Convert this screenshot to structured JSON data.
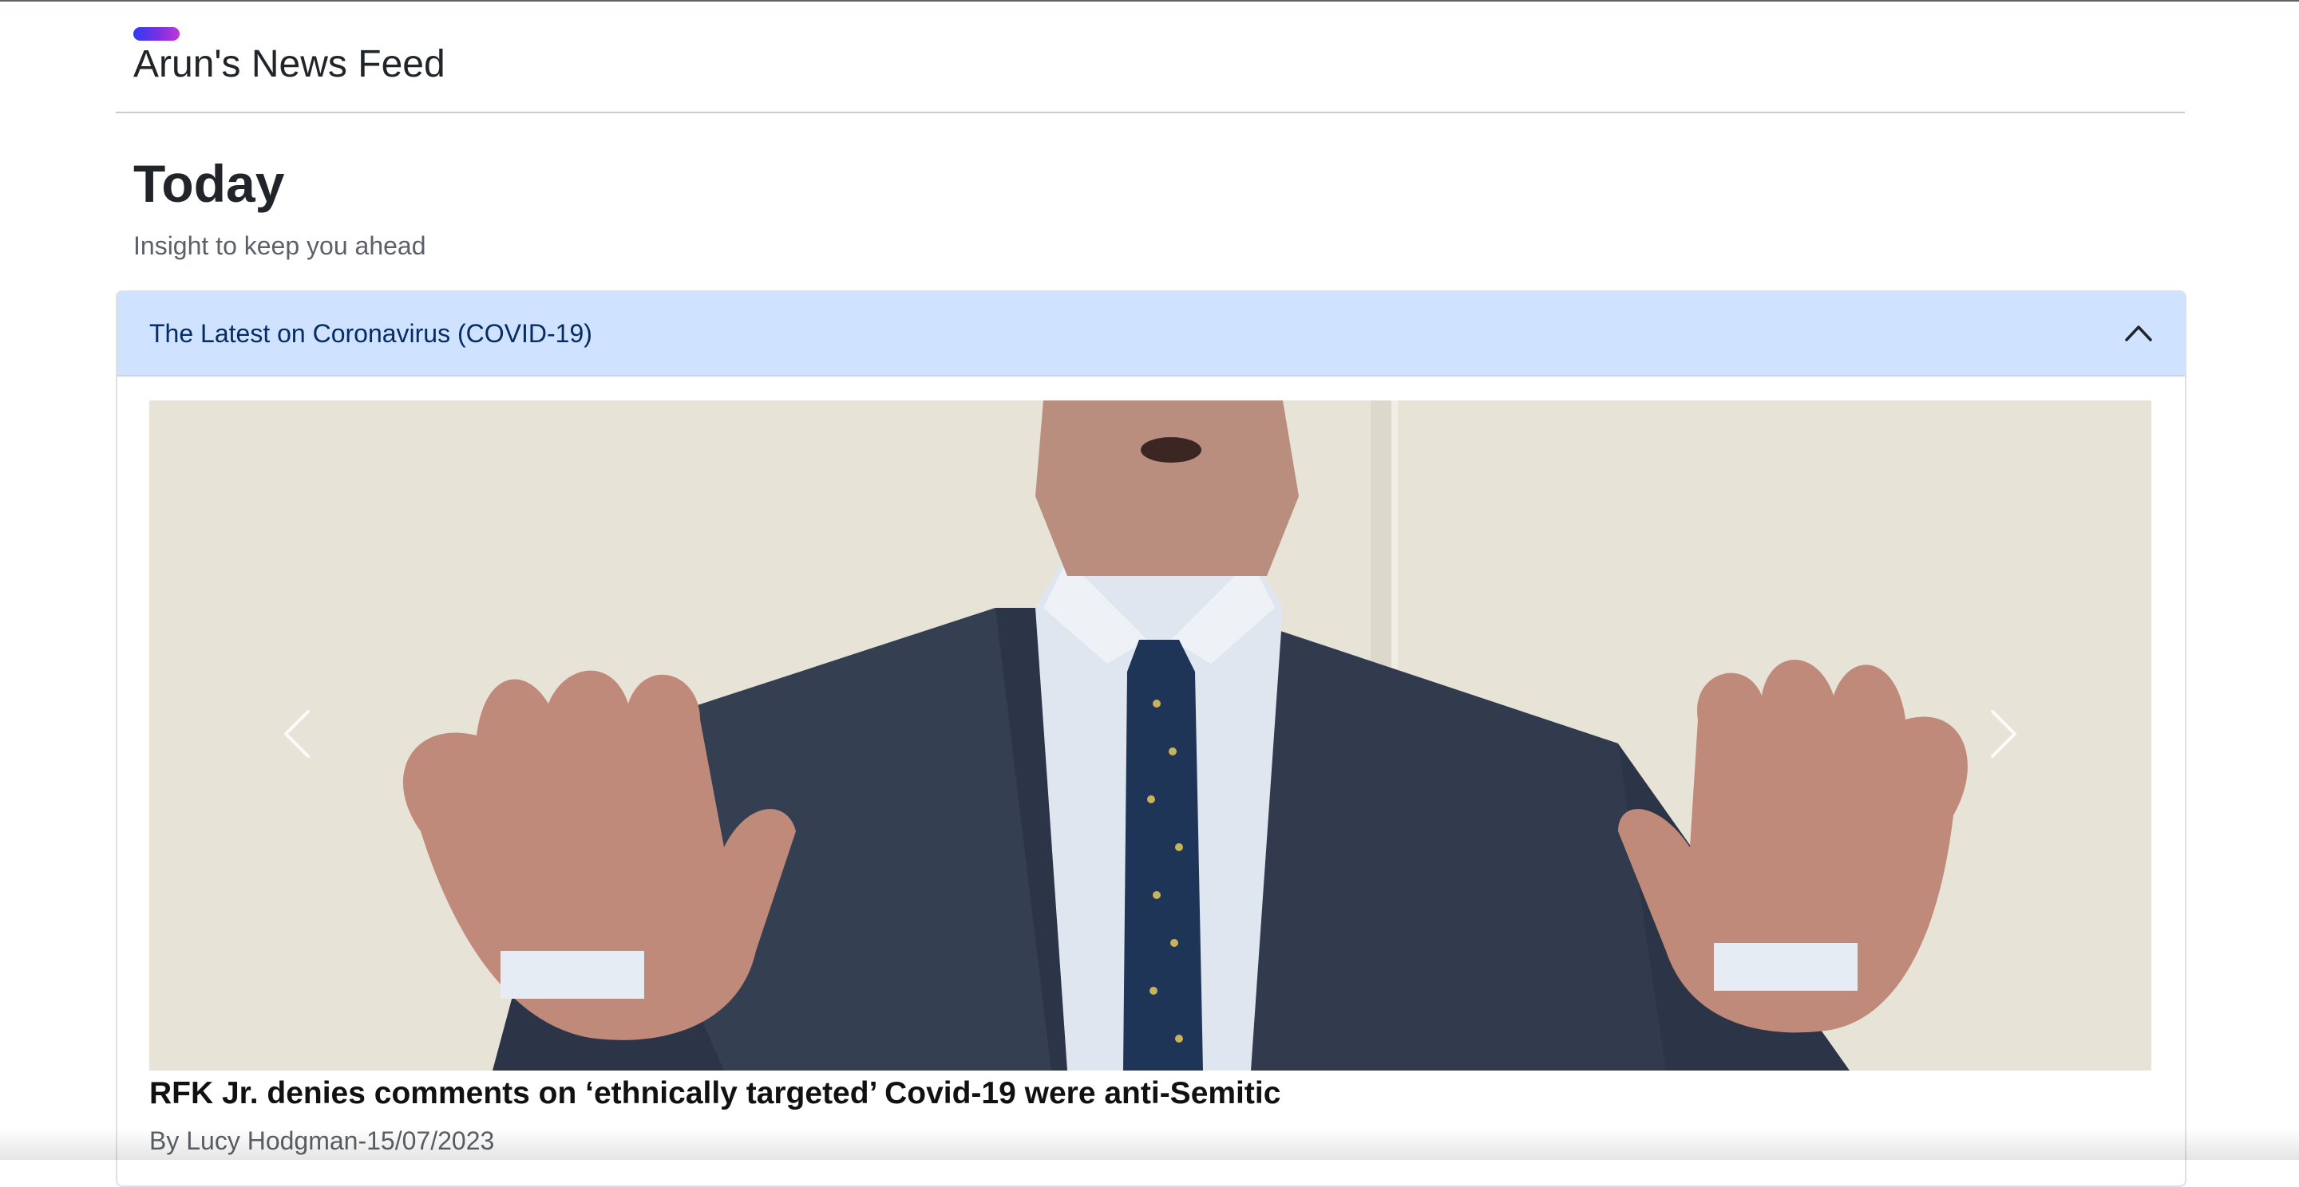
{
  "navbar": {
    "brand": "Arun's News Feed",
    "brand_gradient": [
      "#2f3cf0",
      "#7a2fe3",
      "#c237d6"
    ]
  },
  "page": {
    "title": "Today",
    "subtitle": "Insight to keep you ahead"
  },
  "accordion": {
    "section_title": "The Latest on Coronavirus (COVID-19)",
    "expanded": true,
    "header_bg": "#cfe2ff",
    "toggle_icon": "chevron-up-icon"
  },
  "carousel": {
    "prev_icon": "chevron-left-icon",
    "next_icon": "chevron-right-icon",
    "slide": {
      "title": "RFK Jr. denies comments on ‘ethnically targeted’ Covid-19 were anti-Semitic",
      "byline": "By Lucy Hodgman-15/07/2023"
    }
  }
}
